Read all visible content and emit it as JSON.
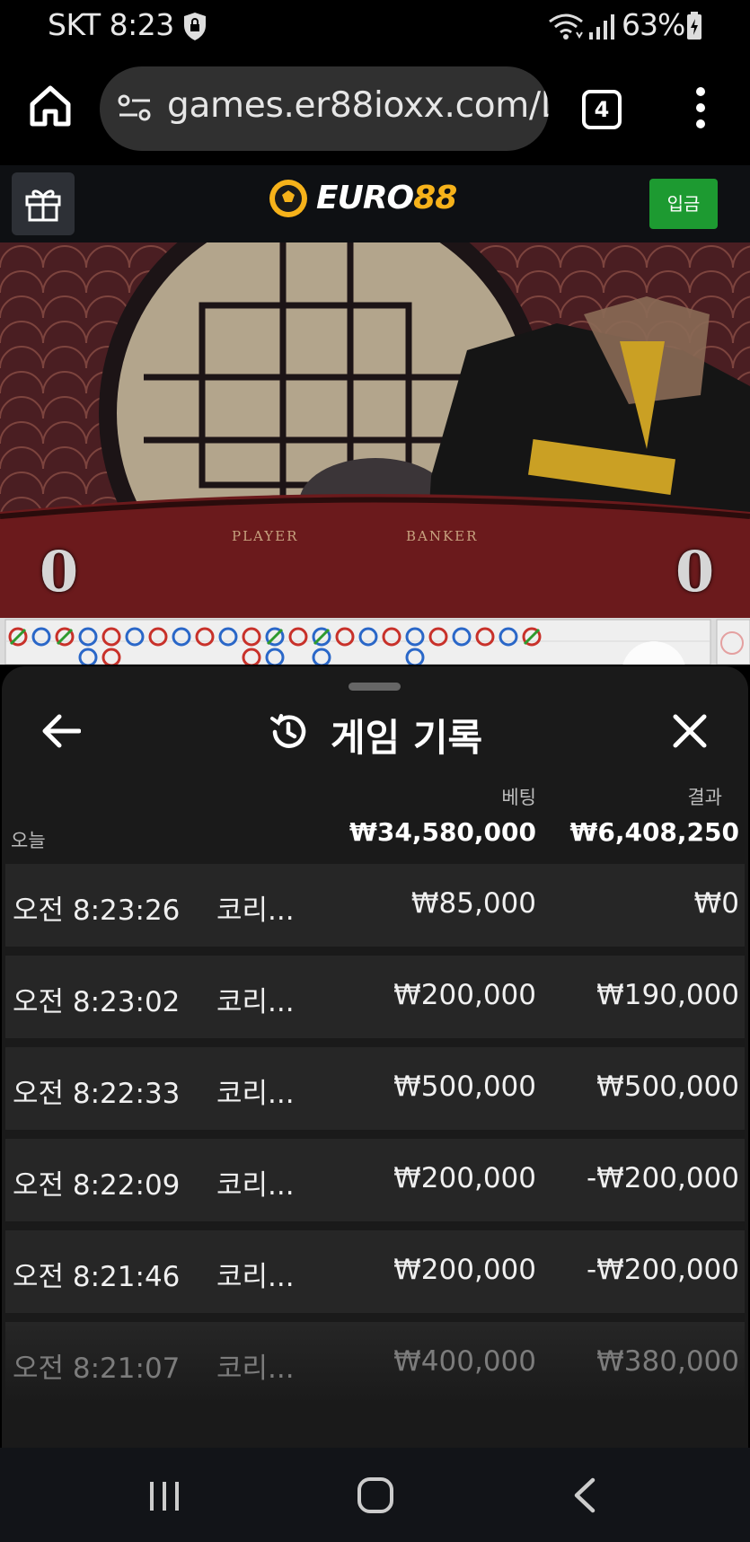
{
  "status_bar": {
    "carrier_time": "SKT 8:23",
    "battery": "63%",
    "icons": [
      "lock-icon",
      "wifi-icon",
      "signal-icon",
      "battery-icon"
    ]
  },
  "browser": {
    "url": "games.er88ioxx.com/L",
    "tab_count": "4",
    "icons": [
      "home-icon",
      "site-info-icon",
      "menu-icon"
    ]
  },
  "site_header": {
    "logo_text_euro": "EURO",
    "logo_text_num": "88",
    "deposit_label": "입금",
    "colors": {
      "accent_gold": "#f6b21a",
      "deposit_green": "#1d9a31"
    }
  },
  "video": {
    "player_label": "PLAYER",
    "banker_label": "BANKER",
    "player_score": "0",
    "banker_score": "0"
  },
  "game_history": {
    "title": "게임 기록",
    "col_bet": "베팅",
    "col_result": "결과",
    "summary_label": "오늘",
    "summary_bet": "₩34,580,000",
    "summary_result": "₩6,408,250",
    "rows": [
      {
        "time": "오전 8:23:26",
        "game": "코리...",
        "bet": "₩85,000",
        "result": "₩0"
      },
      {
        "time": "오전 8:23:02",
        "game": "코리...",
        "bet": "₩200,000",
        "result": "₩190,000"
      },
      {
        "time": "오전 8:22:33",
        "game": "코리...",
        "bet": "₩500,000",
        "result": "₩500,000"
      },
      {
        "time": "오전 8:22:09",
        "game": "코리...",
        "bet": "₩200,000",
        "result": "-₩200,000"
      },
      {
        "time": "오전 8:21:46",
        "game": "코리...",
        "bet": "₩200,000",
        "result": "-₩200,000"
      },
      {
        "time": "오전 8:21:07",
        "game": "코리...",
        "bet": "₩400,000",
        "result": "₩380,000"
      }
    ]
  }
}
